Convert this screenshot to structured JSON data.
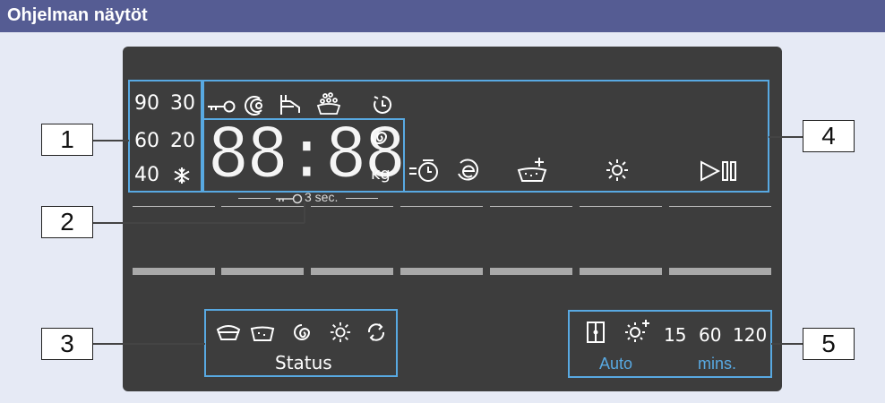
{
  "title": "Ohjelman näytöt",
  "temps": [
    "90",
    "30",
    "60",
    "20",
    "40"
  ],
  "display": {
    "digits": "88:88",
    "unit": "kg",
    "lock_hint": "3 sec."
  },
  "status": {
    "label": "Status"
  },
  "section5": {
    "values": [
      "15",
      "60",
      "120"
    ],
    "auto": "Auto",
    "mins": "mins."
  },
  "callouts": [
    "1",
    "2",
    "3",
    "4",
    "5"
  ],
  "colors": {
    "title_bg": "#555c93",
    "panel_bg": "#3d3d3d",
    "highlight": "#58a9e2",
    "page_bg": "#e6eaf5"
  },
  "icons": [
    "key-icon",
    "intensive-icon",
    "rinse-tap-icon",
    "prewash-icon",
    "timer-icon",
    "snowflake-icon",
    "spin-icon",
    "end-time-icon",
    "eco-icon",
    "extra-rinse-icon",
    "dry-icon",
    "start-pause-icon",
    "wash-icon",
    "rinse-icon",
    "spin-status-icon",
    "dry-status-icon",
    "anti-crease-icon",
    "door-icon",
    "dry-plus-icon"
  ]
}
